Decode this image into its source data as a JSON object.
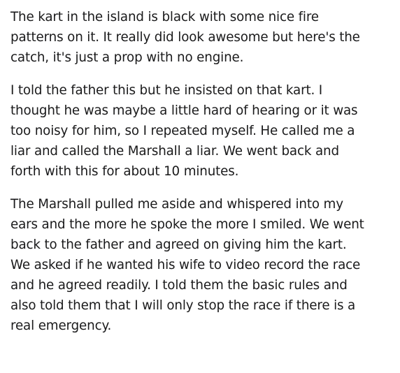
{
  "post": {
    "paragraphs": [
      {
        "lines": [
          "The kart in the island is black with some nice fire",
          "patterns on it. It really did look awesome but here's the",
          "catch, it's just a prop with no engine."
        ]
      },
      {
        "lines": [
          "I told the father this but he insisted on that kart. I",
          "thought he was maybe a little hard of hearing or it was",
          "too noisy for him, so I repeated myself. He called me a",
          "liar and called the Marshall a liar. We went back and",
          "forth with this for about 10 minutes."
        ]
      },
      {
        "lines": [
          "The Marshall pulled me aside and whispered into my",
          "ears and the more he spoke the more I smiled. We went",
          "back to the father and agreed on giving him the kart.",
          "We asked if he wanted his wife to video record the race",
          "and he agreed readily. I told them the basic rules and",
          "also told them that I will only stop the race if there is a",
          "real emergency."
        ]
      }
    ]
  }
}
